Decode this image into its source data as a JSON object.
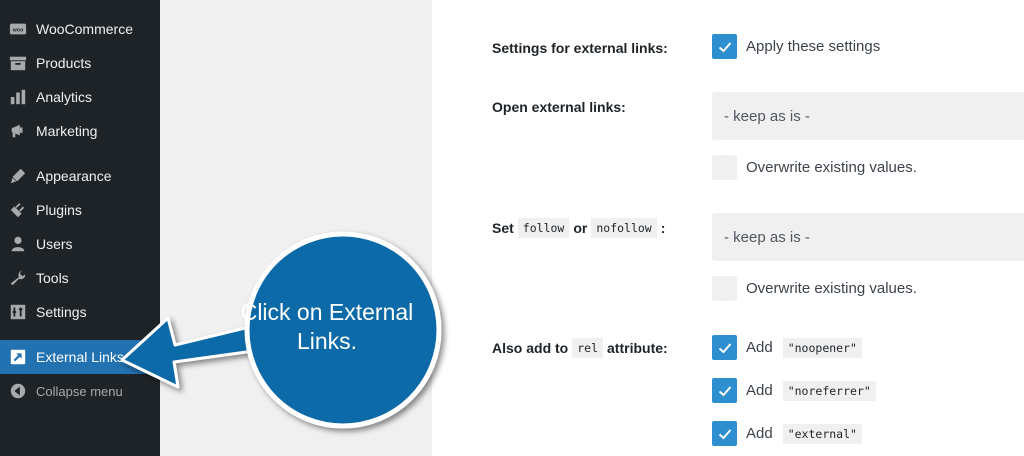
{
  "sidebar": {
    "items": [
      {
        "label": "WooCommerce",
        "icon": "woocommerce-icon"
      },
      {
        "label": "Products",
        "icon": "products-icon"
      },
      {
        "label": "Analytics",
        "icon": "analytics-icon"
      },
      {
        "label": "Marketing",
        "icon": "marketing-icon"
      },
      {
        "label": "Appearance",
        "icon": "appearance-icon"
      },
      {
        "label": "Plugins",
        "icon": "plugins-icon"
      },
      {
        "label": "Users",
        "icon": "users-icon"
      },
      {
        "label": "Tools",
        "icon": "tools-icon"
      },
      {
        "label": "Settings",
        "icon": "settings-icon"
      },
      {
        "label": "External Links",
        "icon": "external-links-icon",
        "active": true
      },
      {
        "label": "Collapse menu",
        "icon": "collapse-icon"
      }
    ]
  },
  "settings": {
    "external_links": {
      "label": "Settings for external links:",
      "checkbox_label": "Apply these settings",
      "checked": true
    },
    "open_external": {
      "label": "Open external links:",
      "select_value": "- keep as is -",
      "overwrite_label": "Overwrite existing values.",
      "overwrite_checked": false
    },
    "follow": {
      "label_prefix": "Set",
      "code1": "follow",
      "label_mid": "or",
      "code2": "nofollow",
      "label_suffix": ":",
      "select_value": "- keep as is -",
      "overwrite_label": "Overwrite existing values.",
      "overwrite_checked": false
    },
    "rel": {
      "label_prefix": "Also add to",
      "code": "rel",
      "label_suffix": "attribute:",
      "options": [
        {
          "prefix": "Add",
          "value": "\"noopener\"",
          "checked": true
        },
        {
          "prefix": "Add",
          "value": "\"noreferrer\"",
          "checked": true
        },
        {
          "prefix": "Add",
          "value": "\"external\"",
          "checked": true
        }
      ]
    }
  },
  "callout": {
    "text": "Click on External Links.",
    "color": "#0e6aa8"
  },
  "colors": {
    "sidebar_bg": "#1d2327",
    "active_bg": "#2271b1",
    "checkbox_blue": "#2e8fd0"
  }
}
